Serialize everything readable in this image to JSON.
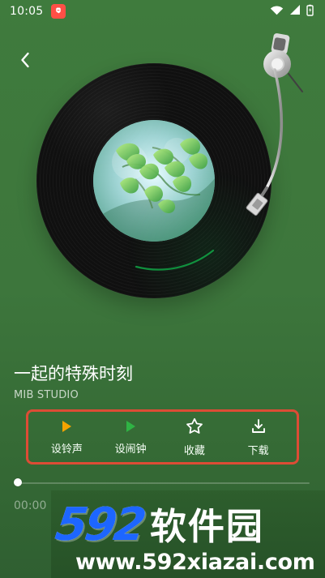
{
  "status_bar": {
    "time": "10:05",
    "notification_icon": "app-badge-icon",
    "signal_icon": "wifi-icon",
    "cell_icon": "cellular-icon",
    "battery_icon": "battery-icon"
  },
  "navigation": {
    "back_icon": "chevron-left-icon"
  },
  "player": {
    "album_icon": "vinyl-record-icon",
    "tonearm_icon": "turntable-arm-icon",
    "title": "一起的特殊时刻",
    "artist": "MIB STUDIO",
    "progress_fraction": 0,
    "elapsed": "00:00"
  },
  "actions": [
    {
      "label": "设铃声",
      "icon": "play-triangle-icon",
      "color": "#f4a300"
    },
    {
      "label": "设闹钟",
      "icon": "play-triangle-icon",
      "color": "#2fb344"
    },
    {
      "label": "收藏",
      "icon": "star-icon",
      "color": "#ffffff"
    },
    {
      "label": "下载",
      "icon": "download-icon",
      "color": "#ffffff"
    }
  ],
  "watermark": {
    "number": "592",
    "text": "软件园",
    "url": "www.592xiazai.com"
  },
  "colors": {
    "background": "#3f7b3d",
    "highlight_border": "#dd4c35",
    "progress": "#ffffff",
    "watermark_blue": "#1d66ff"
  }
}
